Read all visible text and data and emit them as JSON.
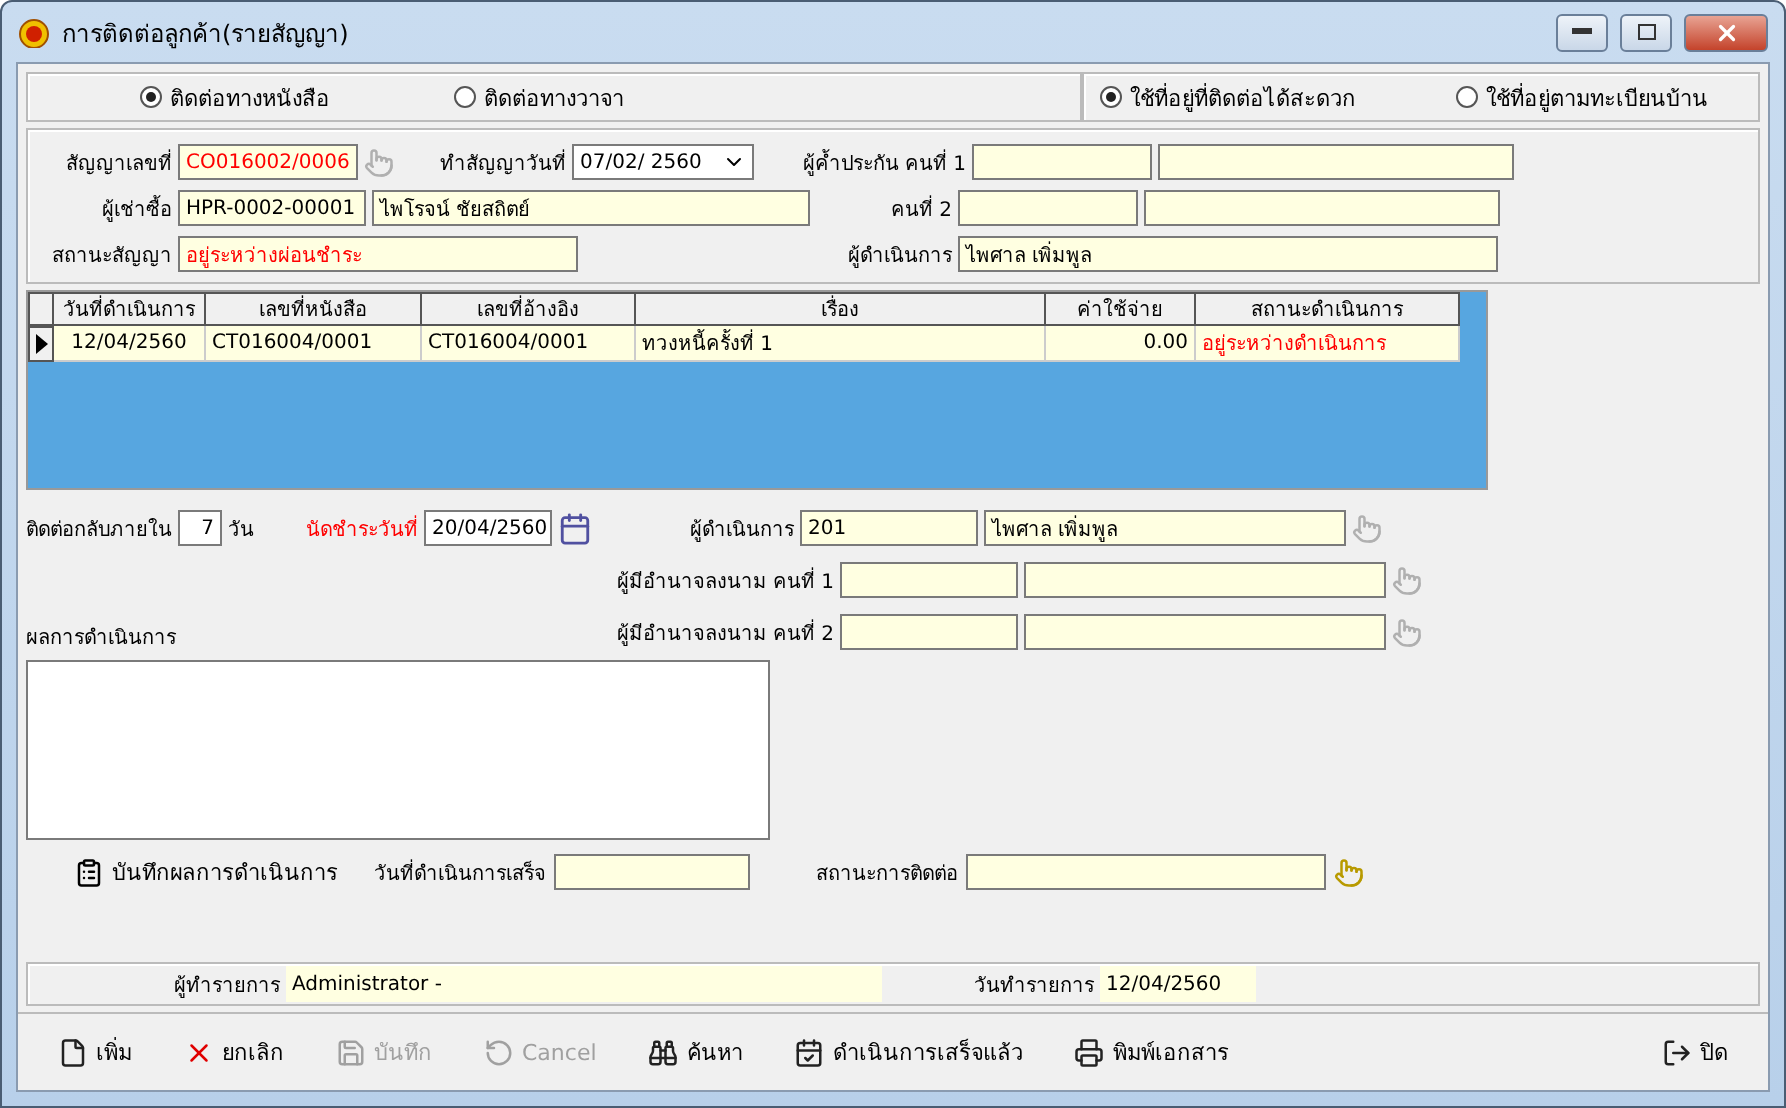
{
  "window": {
    "title": "การติดต่อลูกค้า(รายสัญญา)"
  },
  "contact_type": [
    {
      "label": "ติดต่อทางหนังสือ",
      "selected": true
    },
    {
      "label": "ติดต่อทางวาจา",
      "selected": false
    }
  ],
  "address_type": [
    {
      "label": "ใช้ที่อยู่ที่ติดต่อได้สะดวก",
      "selected": true
    },
    {
      "label": "ใช้ที่อยู่ตามทะเบียนบ้าน",
      "selected": false
    }
  ],
  "contract": {
    "contract_no": {
      "label": "สัญญาเลขที่",
      "value": "CO016002/0006",
      "lookup_enabled": false
    },
    "contract_date": {
      "label": "ทำสัญญาวันที่",
      "value": "07/02/ 2560"
    },
    "guarantor_1": {
      "label": "ผู้ค้ำประกัน คนที่ 1"
    },
    "hirer": {
      "label": "ผู้เช่าซื้อ",
      "code": "HPR-0002-00001",
      "name": "ไพโรจน์ ชัยสถิตย์"
    },
    "guarantor_2": {
      "label": "คนที่ 2"
    },
    "status": {
      "label": "สถานะสัญญา",
      "value": "อยู่ระหว่างผ่อนชำระ"
    },
    "operator": {
      "label": "ผู้ดำเนินการ",
      "value": "ไพศาล เพิ่มพูล"
    }
  },
  "table": {
    "columns": [
      {
        "label": "วันที่ดำเนินการ",
        "alert": false
      },
      {
        "label": "เลขที่หนังสือ",
        "alert": false
      },
      {
        "label": "เลขที่อ้างอิง",
        "alert": false
      },
      {
        "label": "เรื่อง",
        "alert": false
      },
      {
        "label": "ค่าใช้จ่าย",
        "alert": false
      },
      {
        "label": "สถานะดำเนินการ",
        "alert": true
      }
    ],
    "rows": [
      {
        "selected": true,
        "cells": [
          "12/04/2560",
          "CT016004/0001",
          "CT016004/0001",
          "ทวงหนี้ครั้งที่ 1",
          "0.00",
          "อยู่ระหว่างดำเนินการ"
        ]
      }
    ]
  },
  "follow_up": {
    "label": "ติดต่อกลับภายใน",
    "value": "7",
    "unit": "วัน"
  },
  "due_date": {
    "label": "นัดชำระวันที่",
    "value": "20/04/2560"
  },
  "assignee": {
    "label": "ผู้ดำเนินการ",
    "code": "201",
    "name": "ไพศาล เพิ่มพูล",
    "lookup_enabled": false
  },
  "signers": [
    {
      "label": "ผู้มีอำนาจลงนาม คนที่ 1",
      "lookup_enabled": false
    },
    {
      "label": "ผู้มีอำนาจลงนาม คนที่ 2",
      "lookup_enabled": false
    }
  ],
  "result": {
    "label": "ผลการดำเนินการ"
  },
  "save_result": {
    "label": "บันทึกผลการดำเนินการ"
  },
  "done_date": {
    "label": "วันที่ดำเนินการเสร็จ"
  },
  "contact_status": {
    "label": "สถานะการติดต่อ",
    "lookup_enabled": true
  },
  "status_bar": {
    "recorder": {
      "label": "ผู้ทำรายการ",
      "value": "Administrator -"
    },
    "record_date": {
      "label": "วันทำรายการ",
      "value": "12/04/2560"
    }
  },
  "toolbar": [
    {
      "kind": "new",
      "label": "เพิ่ม",
      "disabled": false
    },
    {
      "kind": "cancel",
      "label": "ยกเลิก",
      "disabled": false
    },
    {
      "kind": "save",
      "label": "บันทึก",
      "disabled": true
    },
    {
      "kind": "undo",
      "label": "Cancel",
      "disabled": true
    },
    {
      "kind": "search",
      "label": "ค้นหา",
      "disabled": false
    },
    {
      "kind": "done",
      "label": "ดำเนินการเสร็จแล้ว",
      "disabled": false
    },
    {
      "kind": "print",
      "label": "พิมพ์เอกสาร",
      "disabled": false
    },
    {
      "kind": "exit",
      "label": "ปิด",
      "disabled": false
    }
  ]
}
